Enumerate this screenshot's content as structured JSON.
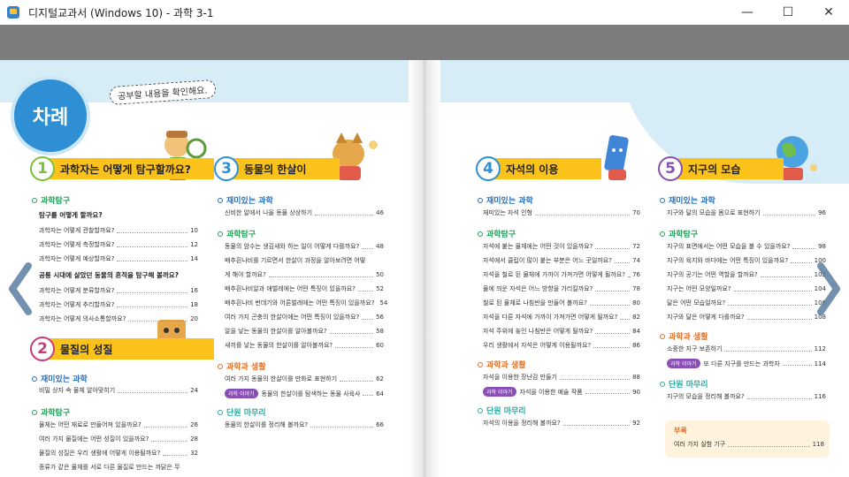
{
  "window": {
    "title": "디지털교과서 (Windows 10) - 과학 3-1",
    "controls": {
      "minimize": "—",
      "maximize": "☐",
      "close": "✕"
    }
  },
  "header": {
    "badge": "차례",
    "bubble": "공부할 내용을 확인해요."
  },
  "chapters": [
    {
      "num": "1",
      "title": "과학자는 어떻게 탐구할까요?",
      "color": "#7cbf3a",
      "sections": [
        {
          "name": "과학탐구",
          "color": "#2a9d5c",
          "items": [
            {
              "sub": "탐구를 어떻게 할까요?"
            },
            {
              "text": "과학자는 어떻게 관찰할까요?",
              "page": "10"
            },
            {
              "text": "과학자는 어떻게 측정할까요?",
              "page": "12"
            },
            {
              "text": "과학자는 어떻게 예상할까요?",
              "page": "14"
            },
            {
              "sub": "공룡 시대에 살았던 동물의 흔적을 탐구해 볼까요?"
            },
            {
              "text": "과학자는 어떻게 분류할까요?",
              "page": "16"
            },
            {
              "text": "과학자는 어떻게 추리할까요?",
              "page": "18"
            },
            {
              "text": "과학자는 어떻게 의사소통할까요?",
              "page": "20"
            }
          ]
        }
      ]
    },
    {
      "num": "2",
      "title": "물질의 성질",
      "color": "#c83a7a",
      "sections": [
        {
          "name": "재미있는 과학",
          "color": "#2a6fb8",
          "items": [
            {
              "text": "비밀 상자 속 물체 알아맞히기",
              "page": "24"
            }
          ]
        },
        {
          "name": "과학탐구",
          "color": "#2a9d5c",
          "items": [
            {
              "text": "물체는 어떤 재료로 만들어져 있을까요?",
              "page": "26"
            },
            {
              "text": "여러 가지 물질에는 어떤 성질이 있을까요?",
              "page": "28"
            },
            {
              "text": "물질의 성질은 우리 생활에 어떻게 이용될까요?",
              "page": "32"
            },
            {
              "text": "종류가 같은 물체를 서로 다른 물질로 만드는 까닭은 무",
              "page": ""
            }
          ]
        }
      ]
    },
    {
      "num": "3",
      "title": "동물의 한살이",
      "color": "#2f8fd4",
      "sections": [
        {
          "name": "재미있는 과학",
          "color": "#2a6fb8",
          "items": [
            {
              "text": "신비한 알에서 나올 동물 상상하기",
              "page": "46"
            }
          ]
        },
        {
          "name": "과학탐구",
          "color": "#2a9d5c",
          "items": [
            {
              "text": "동물의 암수는 생김새와 하는 일이 어떻게 다를까요?",
              "page": "48"
            },
            {
              "text": "배추흰나비를 기르면서 한살이 과정을 알아보려면 어떻",
              "page": ""
            },
            {
              "text": "게 해야 할까요?",
              "page": "50"
            },
            {
              "text": "배추흰나비알과 애벌레에는 어떤 특징이 있을까요?",
              "page": "52"
            },
            {
              "text": "배추흰나비 번데기와 어른벌레에는 어떤 특징이 있을까요?",
              "page": "54"
            },
            {
              "text": "여러 가지 곤충의 한살이에는 어떤 특징이 있을까요?",
              "page": "56"
            },
            {
              "text": "알을 낳는 동물의 한살이를 알아볼까요?",
              "page": "58"
            },
            {
              "text": "새끼를 낳는 동물의 한살이를 알아볼까요?",
              "page": "60"
            }
          ]
        },
        {
          "name": "과학과 생활",
          "color": "#e0712b",
          "items": [
            {
              "text": "여러 가지 동물의 한살이를 만화로 표현하기",
              "page": "62"
            },
            {
              "tag": "과학 이야기",
              "text": "동물의 한살이를 탐색하는 동물 사육사",
              "page": "64"
            }
          ]
        },
        {
          "name": "단원 마무리",
          "color": "#2aa9a0",
          "items": [
            {
              "text": "동물의 한살이를 정리해 볼까요?",
              "page": "66"
            }
          ]
        }
      ]
    },
    {
      "num": "4",
      "title": "자석의 이용",
      "color": "#2f8fd4",
      "sections": [
        {
          "name": "재미있는 과학",
          "color": "#2a6fb8",
          "items": [
            {
              "text": "재미있는 자석 인형",
              "page": "70"
            }
          ]
        },
        {
          "name": "과학탐구",
          "color": "#2a9d5c",
          "items": [
            {
              "text": "자석에 붙는 물체에는 어떤 것이 있을까요?",
              "page": "72"
            },
            {
              "text": "자석에서 클립이 많이 붙는 부분은 어느 곳일까요?",
              "page": "74"
            },
            {
              "text": "자석을 철로 된 물체에 가까이 가져가면 어떻게 될까요?",
              "page": "76"
            },
            {
              "text": "물에 띄운 자석은 어느 방향을 가리킬까요?",
              "page": "78"
            },
            {
              "text": "철로 된 물체로 나침반을 만들어 볼까요?",
              "page": "80"
            },
            {
              "text": "자석을 다른 자석에 가까이 가져가면 어떻게 될까요?",
              "page": "82"
            },
            {
              "text": "자석 주위에 놓인 나침반은 어떻게 될까요?",
              "page": "84"
            },
            {
              "text": "우리 생활에서 자석은 어떻게 이용될까요?",
              "page": "86"
            }
          ]
        },
        {
          "name": "과학과 생활",
          "color": "#e0712b",
          "items": [
            {
              "text": "자석을 이용한 장난감 만들기",
              "page": "88"
            },
            {
              "tag": "과학 이야기",
              "text": "자석을 이용한 예술 작품",
              "page": "90"
            }
          ]
        },
        {
          "name": "단원 마무리",
          "color": "#2aa9a0",
          "items": [
            {
              "text": "자석의 이용을 정리해 볼까요?",
              "page": "92"
            }
          ]
        }
      ]
    },
    {
      "num": "5",
      "title": "지구의 모습",
      "color": "#8a4fb5",
      "sections": [
        {
          "name": "재미있는 과학",
          "color": "#2a6fb8",
          "items": [
            {
              "text": "지구와 달의 모습을 몸으로 표현하기",
              "page": "96"
            }
          ]
        },
        {
          "name": "과학탐구",
          "color": "#2a9d5c",
          "items": [
            {
              "text": "지구의 표면에서는 어떤 모습을 볼 수 있을까요?",
              "page": "98"
            },
            {
              "text": "지구의 육지와 바다에는 어떤 특징이 있을까요?",
              "page": "100"
            },
            {
              "text": "지구의 공기는 어떤 역할을 할까요?",
              "page": "102"
            },
            {
              "text": "지구는 어떤 모양일까요?",
              "page": "104"
            },
            {
              "text": "달은 어떤 모습일까요?",
              "page": "106"
            },
            {
              "text": "지구와 달은 어떻게 다를까요?",
              "page": "108"
            }
          ]
        },
        {
          "name": "과학과 생활",
          "color": "#e0712b",
          "items": [
            {
              "text": "소중한 지구 보존하기",
              "page": "112"
            },
            {
              "tag": "과학 이야기",
              "text": "또 다른 지구를 만드는 과학자",
              "page": "114"
            }
          ]
        },
        {
          "name": "단원 마무리",
          "color": "#2aa9a0",
          "items": [
            {
              "text": "지구의 모습을 정리해 볼까요?",
              "page": "116"
            }
          ]
        }
      ]
    }
  ],
  "appendix": {
    "title": "부록",
    "text": "여러 가지 실험 기구",
    "page": "118"
  }
}
